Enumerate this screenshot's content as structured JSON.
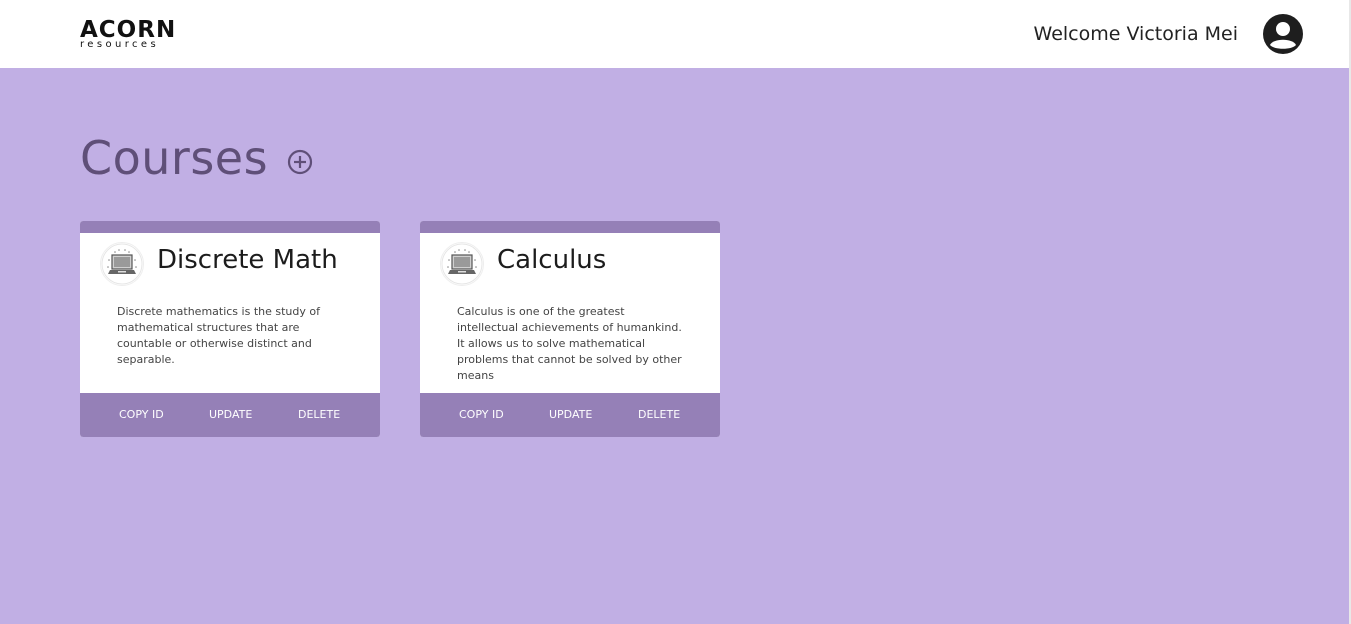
{
  "header": {
    "logo_main": "ACORN",
    "logo_sub": "resources",
    "welcome_text": "Welcome Victoria Mei"
  },
  "page": {
    "title": "Courses",
    "add_icon": "circled-plus-icon"
  },
  "courses": [
    {
      "title": "Discrete Math",
      "description": "Discrete mathematics is the study of mathematical structures that are countable or otherwise distinct and separable.",
      "icon": "course-thumbnail-icon",
      "actions": [
        "COPY ID",
        "UPDATE",
        "DELETE"
      ]
    },
    {
      "title": "Calculus",
      "description": "Calculus is one of the greatest intellectual achievements of humankind. It allows us to solve mathematical problems that cannot be solved by other means",
      "icon": "course-thumbnail-icon",
      "actions": [
        "COPY ID",
        "UPDATE",
        "DELETE"
      ]
    }
  ],
  "colors": {
    "background": "#c1afe4",
    "accent": "#9580b7",
    "title": "#5f4f78"
  }
}
